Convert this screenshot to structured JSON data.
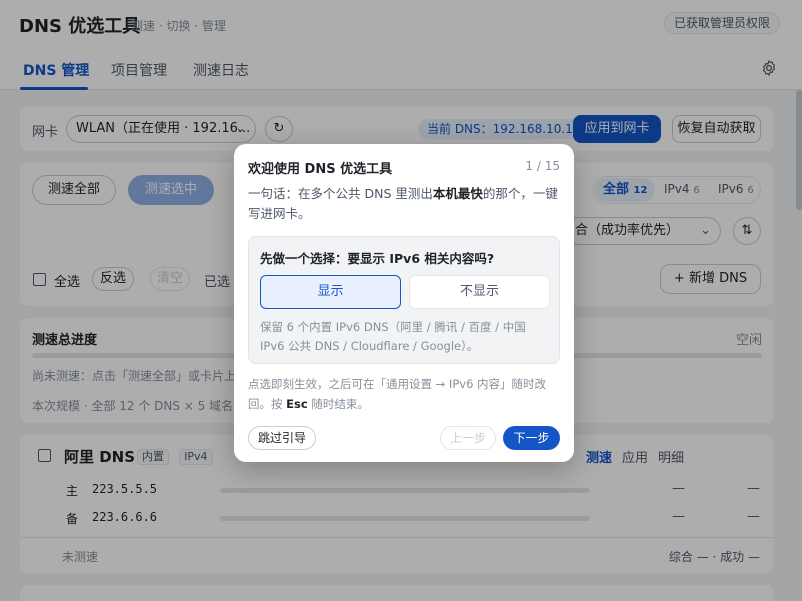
{
  "header": {
    "title": "DNS 优选工具",
    "subtitle": "测速 · 切换 · 管理",
    "admin_badge": "已获取管理员权限"
  },
  "tabs": [
    {
      "label": "DNS 管理",
      "active": true
    },
    {
      "label": "项目管理",
      "active": false
    },
    {
      "label": "测速日志",
      "active": false
    }
  ],
  "nic": {
    "label": "网卡",
    "select_value": "WLAN（正在使用 · 192.16...",
    "current_dns": "当前 DNS：192.168.10.1",
    "apply_button": "应用到网卡",
    "restore_button": "恢复自动获取"
  },
  "toolbar": {
    "test_all": "测速全部",
    "test_selected": "测速选中",
    "filter_all": "全部",
    "filter_all_count": "12",
    "filter_ipv4": "IPv4",
    "filter_ipv4_count": "6",
    "filter_ipv6": "IPv6",
    "filter_ipv6_count": "6",
    "sort_value": "合（成功率优先）",
    "select_all": "全选",
    "invert": "反选",
    "clear": "清空",
    "selected_prefix": "已选",
    "add_dns": "+ 新增 DNS"
  },
  "progress": {
    "title": "测速总进度",
    "status": "空闲",
    "hint": "尚未测速：点击「测速全部」或卡片上",
    "scale": "本次规模 · 全部 12 个 DNS × 5 域名 ×"
  },
  "dns_card": {
    "name": "阿里 DNS",
    "tag_builtin": "内置",
    "tag_ip": "IPv4",
    "actions": [
      "测速",
      "应用",
      "明细"
    ],
    "rows": [
      {
        "role": "主",
        "ip": "223.5.5.5",
        "v1": "—",
        "v2": "—"
      },
      {
        "role": "备",
        "ip": "223.6.6.6",
        "v1": "—",
        "v2": "—"
      }
    ],
    "footer_left": "未测速",
    "footer_right": "综合 — · 成功 —"
  },
  "modal": {
    "title": "欢迎使用 DNS 优选工具",
    "step": "1 / 15",
    "body_prefix": "一句话：在多个公共 DNS 里测出",
    "body_bold": "本机最快",
    "body_suffix": "的那个，一键写进网卡。",
    "question": "先做一个选择：要显示 IPv6 相关内容吗?",
    "option_show": "显示",
    "option_hide": "不显示",
    "choice_note": "保留 6 个内置 IPv6 DNS（阿里 / 腾讯 / 百度 / 中国 IPv6 公共 DNS / Cloudflare / Google）。",
    "note_prefix": "点选即刻生效，之后可在「通用设置 → IPv6 内容」随时改回。按",
    "note_key": "Esc",
    "note_suffix": "随时结束。",
    "skip_button": "跳过引导",
    "prev_button": "上一步",
    "next_button": "下一步"
  },
  "colors": {
    "accent": "#1456c8",
    "overlay": "rgba(0,0,0,0.32)"
  }
}
